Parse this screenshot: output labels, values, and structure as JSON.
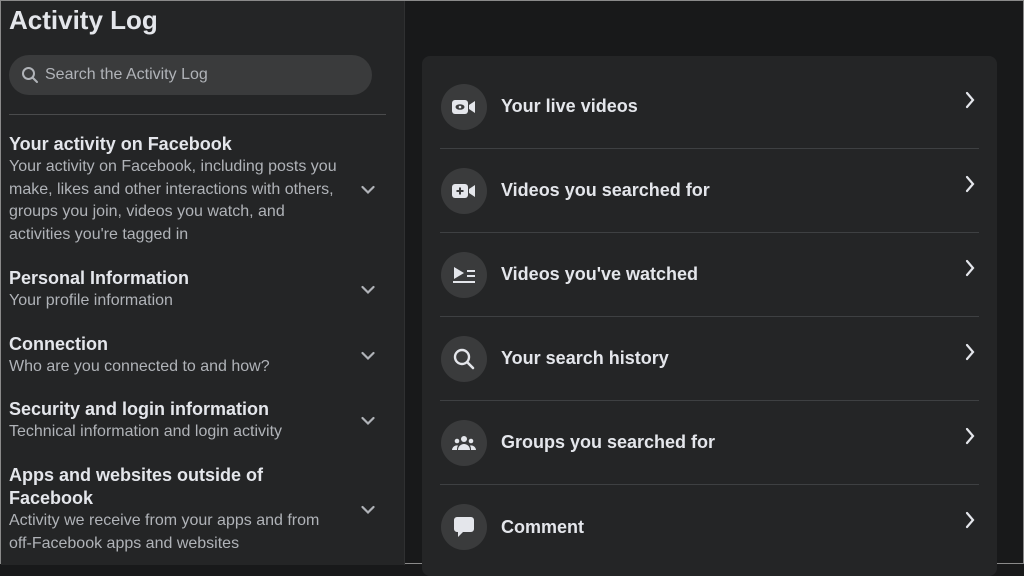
{
  "sidebar": {
    "title": "Activity Log",
    "search_placeholder": "Search the Activity Log",
    "sections": [
      {
        "title": "Your activity on Facebook",
        "desc": "Your activity on Facebook, including posts you make, likes and other interactions with others, groups you join, videos you watch, and activities you're tagged in"
      },
      {
        "title": "Personal Information",
        "desc": "Your profile information"
      },
      {
        "title": "Connection",
        "desc": "Who are you connected to and how?"
      },
      {
        "title": "Security and login information",
        "desc": "Technical information and login activity"
      },
      {
        "title": "Apps and websites outside of Facebook",
        "desc": "Activity we receive from your apps and from off-Facebook apps and websites"
      }
    ]
  },
  "main": {
    "items": [
      {
        "label": "Your live videos",
        "icon": "live-video-icon"
      },
      {
        "label": "Videos you searched for",
        "icon": "video-plus-icon"
      },
      {
        "label": "Videos you've watched",
        "icon": "watched-videos-icon"
      },
      {
        "label": "Your search history",
        "icon": "search-icon"
      },
      {
        "label": "Groups you searched for",
        "icon": "groups-icon"
      },
      {
        "label": "Comment",
        "icon": "comment-icon"
      }
    ]
  }
}
